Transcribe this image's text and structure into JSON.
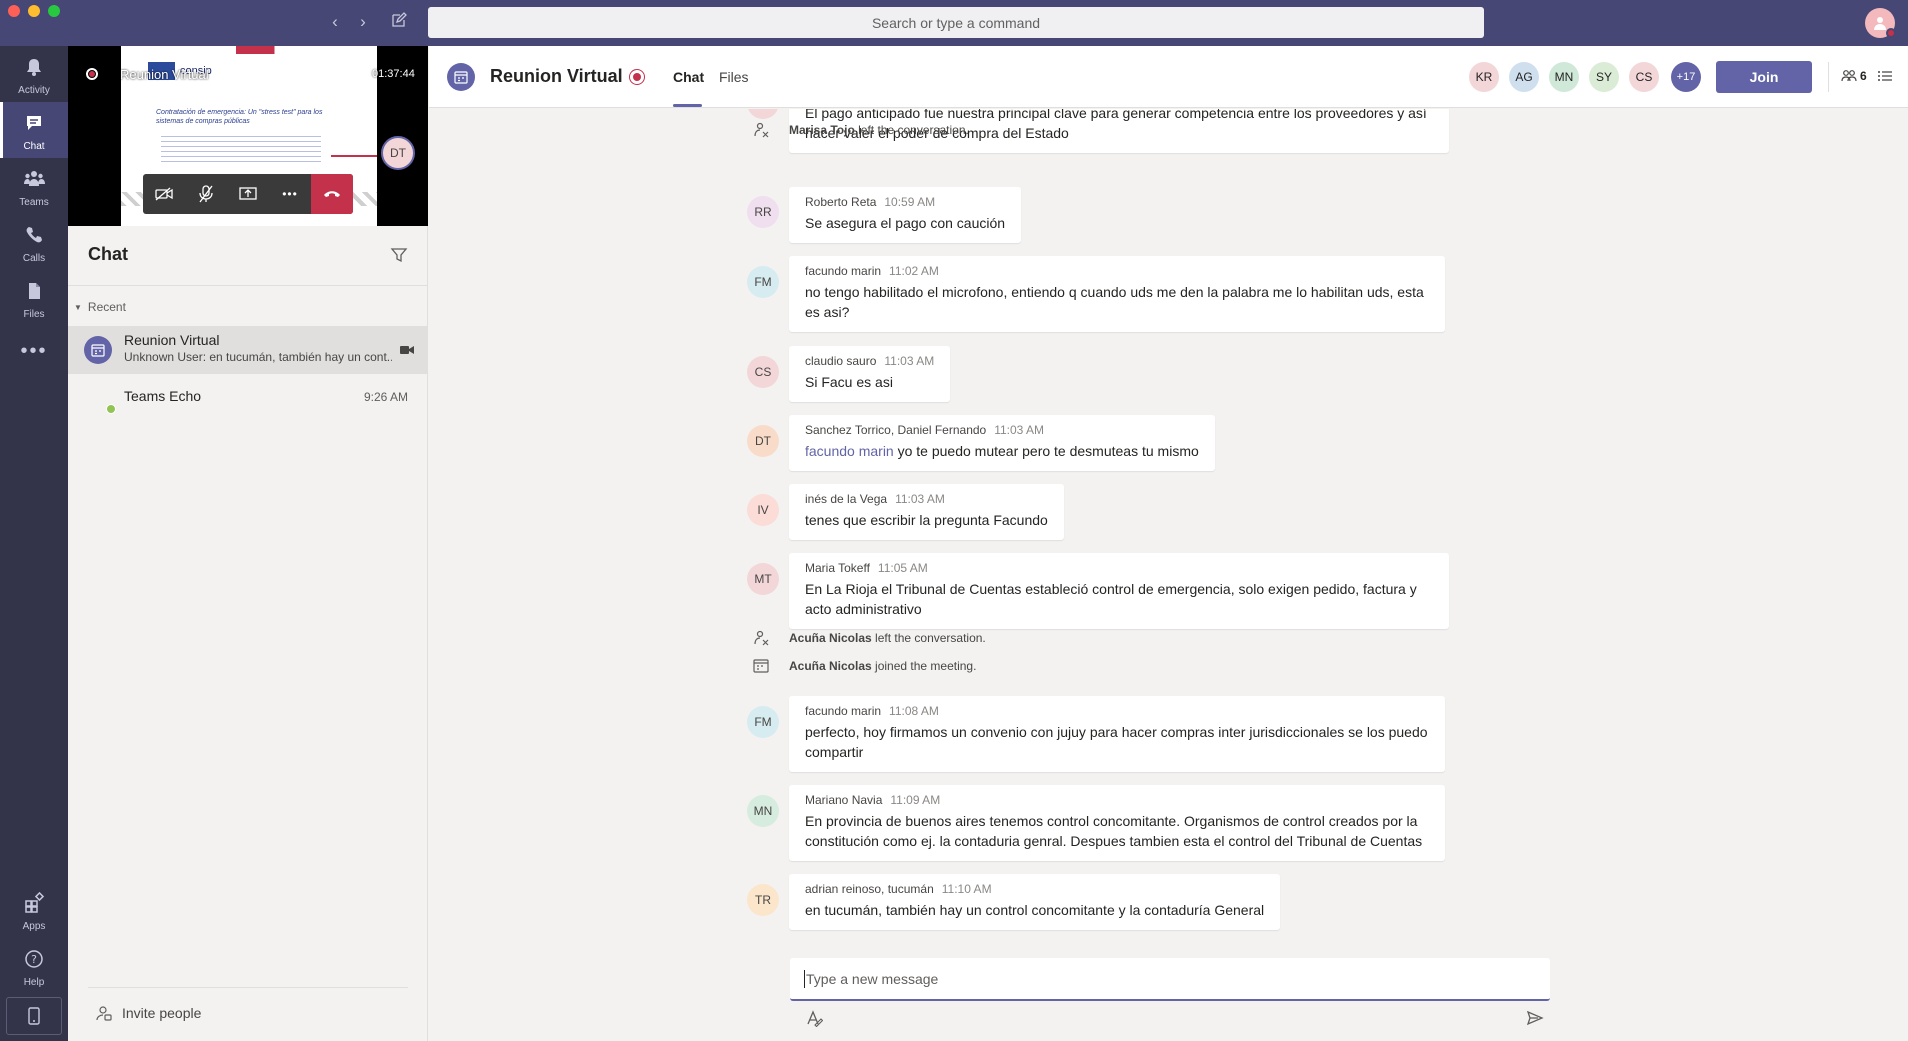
{
  "app": {
    "search_placeholder": "Search or type a command"
  },
  "rail": {
    "items": [
      {
        "label": "Activity",
        "icon": "bell-icon"
      },
      {
        "label": "Chat",
        "icon": "chat-icon"
      },
      {
        "label": "Teams",
        "icon": "teams-icon"
      },
      {
        "label": "Calls",
        "icon": "phone-icon"
      },
      {
        "label": "Files",
        "icon": "file-icon"
      },
      {
        "label": "Apps",
        "icon": "apps-icon"
      },
      {
        "label": "Help",
        "icon": "help-icon"
      }
    ]
  },
  "call": {
    "title": "Reunion Virtual",
    "timer": "01:37:44",
    "presenter_initials": "DT",
    "slide_brand": "consip",
    "slide_heading": "Contratación de emergencia: Un \"stress test\" para los sistemas de compras públicas"
  },
  "chat_list": {
    "title": "Chat",
    "section": "Recent",
    "items": [
      {
        "name": "Reunion Virtual",
        "preview": "Unknown User: en tucumán, también hay un cont...",
        "time": ""
      },
      {
        "name": "Teams Echo",
        "preview": "",
        "time": "9:26 AM"
      }
    ],
    "invite": "Invite people"
  },
  "conversation": {
    "title": "Reunion Virtual",
    "tabs": [
      "Chat",
      "Files"
    ],
    "participants": [
      "KR",
      "AG",
      "MN",
      "SY",
      "CS"
    ],
    "more_count": "+17",
    "join_label": "Join",
    "people_count": "6",
    "partial_message": {
      "line1": "El pago anticipado fue nuestra principal clave para generar competencia entre los proveedores y así",
      "line2": "hacer valer el poder de compra del Estado"
    },
    "system_events": [
      {
        "name": "Marisa Tojo",
        "text": " left the conversation."
      },
      {
        "name": "Acuña Nicolas",
        "text": " left the conversation."
      },
      {
        "name": "Acuña Nicolas",
        "text": " joined the meeting."
      }
    ],
    "messages": [
      {
        "initials": "RR",
        "author": "Roberto Reta",
        "time": "10:59 AM",
        "line1": "Se asegura el pago con caución",
        "line2": ""
      },
      {
        "initials": "FM",
        "author": "facundo marin",
        "time": "11:02 AM",
        "line1": "no tengo habilitado el microfono, entiendo q cuando uds me den la palabra me lo habilitan uds, esta",
        "line2": "es asi?"
      },
      {
        "initials": "CS",
        "author": "claudio sauro",
        "time": "11:03 AM",
        "line1": "Si Facu es asi",
        "line2": ""
      },
      {
        "initials": "DT",
        "author": "Sanchez Torrico, Daniel Fernando",
        "time": "11:03 AM",
        "mention": "facundo marin",
        "line1": " yo te puedo mutear pero te desmuteas tu mismo",
        "line2": ""
      },
      {
        "initials": "IV",
        "author": "inés de la Vega",
        "time": "11:03 AM",
        "line1": "tenes que escribir la pregunta Facundo",
        "line2": ""
      },
      {
        "initials": "MT",
        "author": "Maria Tokeff",
        "time": "11:05 AM",
        "line1": "En La Rioja el Tribunal de Cuentas estableció control de emergencia, solo exigen pedido, factura y",
        "line2": "acto administrativo"
      },
      {
        "initials": "FM",
        "author": "facundo marin",
        "time": "11:08 AM",
        "line1": "perfecto, hoy firmamos un convenio con jujuy para hacer compras inter jurisdiccionales se los puedo",
        "line2": "compartir"
      },
      {
        "initials": "MN",
        "author": "Mariano Navia",
        "time": "11:09 AM",
        "line1": "En provincia de buenos aires tenemos control concomitante. Organismos de control creados por la",
        "line2": "constitución como ej. la contaduria genral. Despues tambien esta el control del Tribunal de Cuentas"
      },
      {
        "initials": "TR",
        "author": "adrian reinoso, tucumán",
        "time": "11:10 AM",
        "line1": "en tucumán, también hay un control concomitante y la contaduría General",
        "line2": ""
      }
    ],
    "compose_placeholder": "Type a new message"
  }
}
